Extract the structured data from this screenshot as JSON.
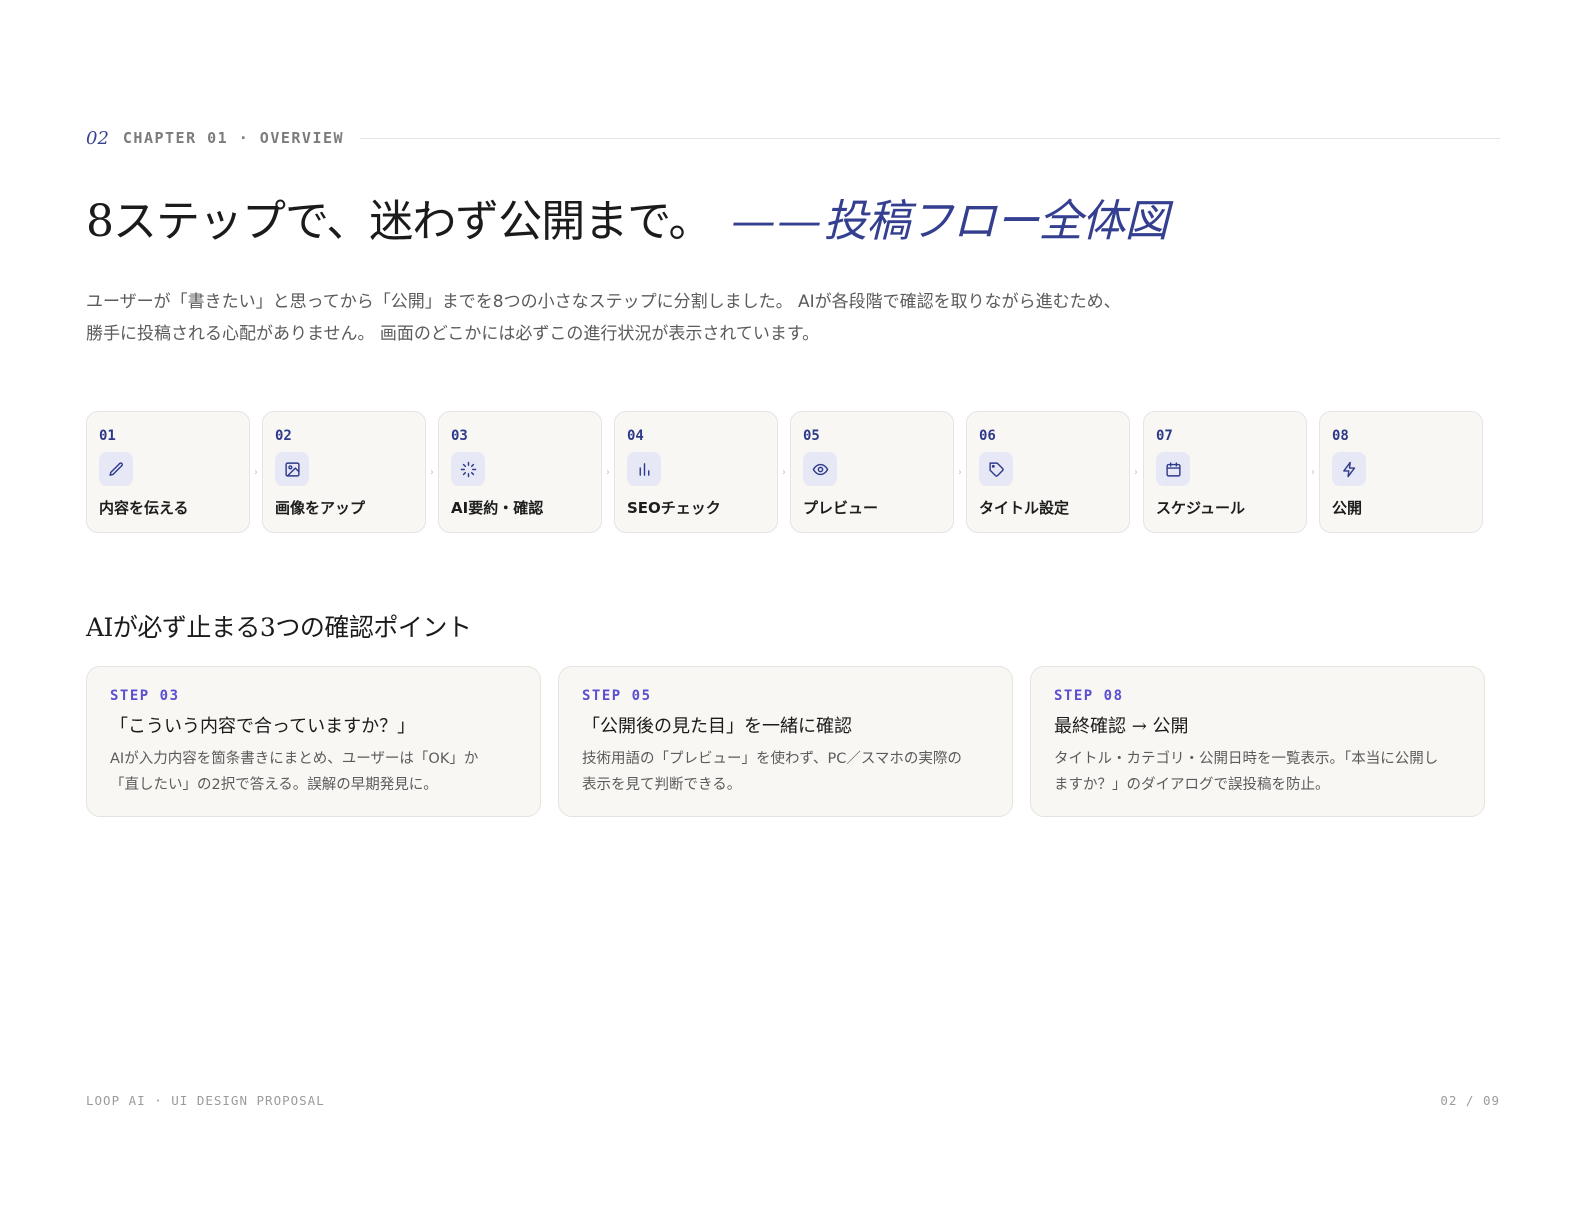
{
  "header": {
    "chapter_number": "02",
    "chapter_label": "CHAPTER 01 · OVERVIEW",
    "headline": "8ステップで、迷わず公開まで。",
    "headline_dash": "——",
    "headline_sub": "投稿フロー全体図",
    "lead_lines": [
      "ユーザーが「書きたい」と思ってから「公開」までを8つの小さなステップに分割しました。 AIが各段階で確認を取りながら進むため、",
      "勝手に投稿される心配がありません。 画面のどこかには必ずこの進行状況が表示されています。"
    ]
  },
  "steps": [
    {
      "num": "01",
      "label": "内容を伝える",
      "icon": "pencil-icon"
    },
    {
      "num": "02",
      "label": "画像をアップ",
      "icon": "image-icon"
    },
    {
      "num": "03",
      "label": "AI要約・確認",
      "icon": "sparkle-icon"
    },
    {
      "num": "04",
      "label": "SEOチェック",
      "icon": "bar-chart-icon"
    },
    {
      "num": "05",
      "label": "プレビュー",
      "icon": "eye-icon"
    },
    {
      "num": "06",
      "label": "タイトル設定",
      "icon": "tag-icon"
    },
    {
      "num": "07",
      "label": "スケジュール",
      "icon": "calendar-icon"
    },
    {
      "num": "08",
      "label": "公開",
      "icon": "lightning-icon"
    }
  ],
  "separator_glyph": "›",
  "checkpoints": {
    "title": "AIが必ず止まる3つの確認ポイント",
    "items": [
      {
        "step": "STEP 03",
        "title": "「こういう内容で合っていますか？」",
        "body_lines": [
          "AIが入力内容を箇条書きにまとめ、ユーザーは「OK」か",
          "「直したい」の2択で答える。誤解の早期発見に。"
        ]
      },
      {
        "step": "STEP 05",
        "title": "「公開後の見た目」を一緒に確認",
        "body_lines": [
          "技術用語の「プレビュー」を使わず、PC／スマホの実際の",
          "表示を見て判断できる。"
        ]
      },
      {
        "step": "STEP 08",
        "title": "最終確認 → 公開",
        "body_lines": [
          "タイトル・カテゴリ・公開日時を一覧表示。「本当に公開し",
          "ますか？」のダイアログで誤投稿を防止。"
        ]
      }
    ]
  },
  "footer": {
    "left": "LOOP AI · UI DESIGN PROPOSAL",
    "right": "02 / 09"
  },
  "colors": {
    "accent": "#34408f",
    "step_label": "#5a4fd0",
    "card_bg": "#f8f7f3",
    "card_border": "#e6e4df",
    "icon_bg": "#e6e8f6"
  }
}
